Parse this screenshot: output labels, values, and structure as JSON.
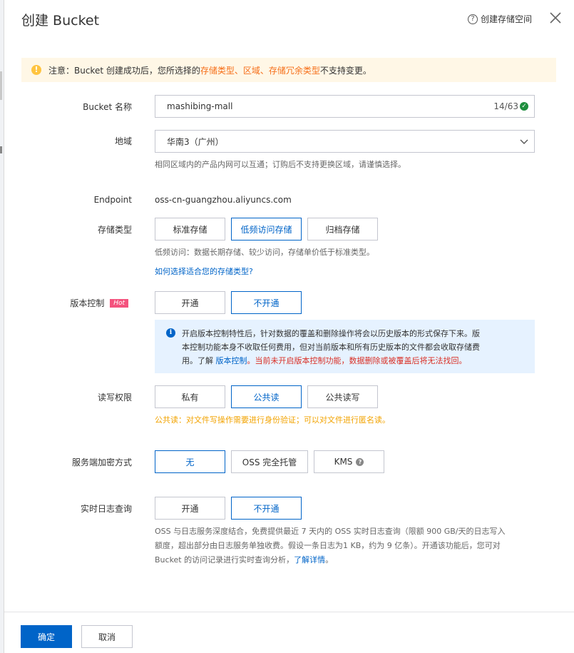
{
  "header": {
    "title": "创建 Bucket",
    "help_link": "创建存储空间"
  },
  "alert": {
    "prefix": "注意：Bucket 创建成功后，您所选择的 ",
    "highlight": "存储类型、区域、存储冗余类型",
    "suffix": " 不支持变更。"
  },
  "bucket_name": {
    "label": "Bucket 名称",
    "value": "mashibing-mall",
    "counter": "14/63"
  },
  "region": {
    "label": "地域",
    "value": "华南3（广州）",
    "hint": "相同区域内的产品内网可以互通；订购后不支持更换区域，请谨慎选择。"
  },
  "endpoint": {
    "label": "Endpoint",
    "value": "oss-cn-guangzhou.aliyuncs.com"
  },
  "storage_class": {
    "label": "存储类型",
    "options": [
      "标准存储",
      "低频访问存储",
      "归档存储"
    ],
    "selected": "低频访问存储",
    "hint": "低频访问：数据长期存储、较少访问，存储单价低于标准类型。",
    "link": "如何选择适合您的存储类型?"
  },
  "versioning": {
    "label": "版本控制",
    "badge": "Hot",
    "options": [
      "开通",
      "不开通"
    ],
    "selected": "不开通",
    "info_line1": "开启版本控制特性后，针对数据的覆盖和删除操作将会以历史版本的形式保存下来。版",
    "info_line2": "本控制功能本身不收取任何费用，但对当前版本和所有历史版本的文件都会收取存储费",
    "info_line3_prefix": "用。了解 ",
    "info_link": "版本控制",
    "info_warn": "。当前未开启版本控制功能，数据删除或被覆盖后将无法找回。"
  },
  "acl": {
    "label": "读写权限",
    "options": [
      "私有",
      "公共读",
      "公共读写"
    ],
    "selected": "公共读",
    "note": "公共读：对文件写操作需要进行身份验证；可以对文件进行匿名读。"
  },
  "encryption": {
    "label": "服务端加密方式",
    "options": [
      "无",
      "OSS 完全托管",
      "KMS"
    ],
    "selected": "无"
  },
  "realtime_log": {
    "label": "实时日志查询",
    "options": [
      "开通",
      "不开通"
    ],
    "selected": "不开通",
    "hint_line1": "OSS 与日志服务深度结合，免费提供最近 7 天内的 OSS 实时日志查询（限额 900 GB/天的日志写入",
    "hint_line2": "额度，超出部分由日志服务单独收费。假设一条日志为1 KB，约为 9 亿条）。开通该功能后，您可对",
    "hint_line3_prefix": "Bucket 的访问记录进行实时查询分析，",
    "hint_link": "了解详情",
    "hint_line3_suffix": "。"
  },
  "footer": {
    "confirm": "确定",
    "cancel": "取消"
  },
  "colors": {
    "primary": "#0064c8",
    "warning_bg": "#fff7e6",
    "info_bg": "#e6f2ff",
    "orange": "#f6701a",
    "red": "#d93026",
    "yellow": "#f2a300",
    "hot": "#f4527d"
  }
}
